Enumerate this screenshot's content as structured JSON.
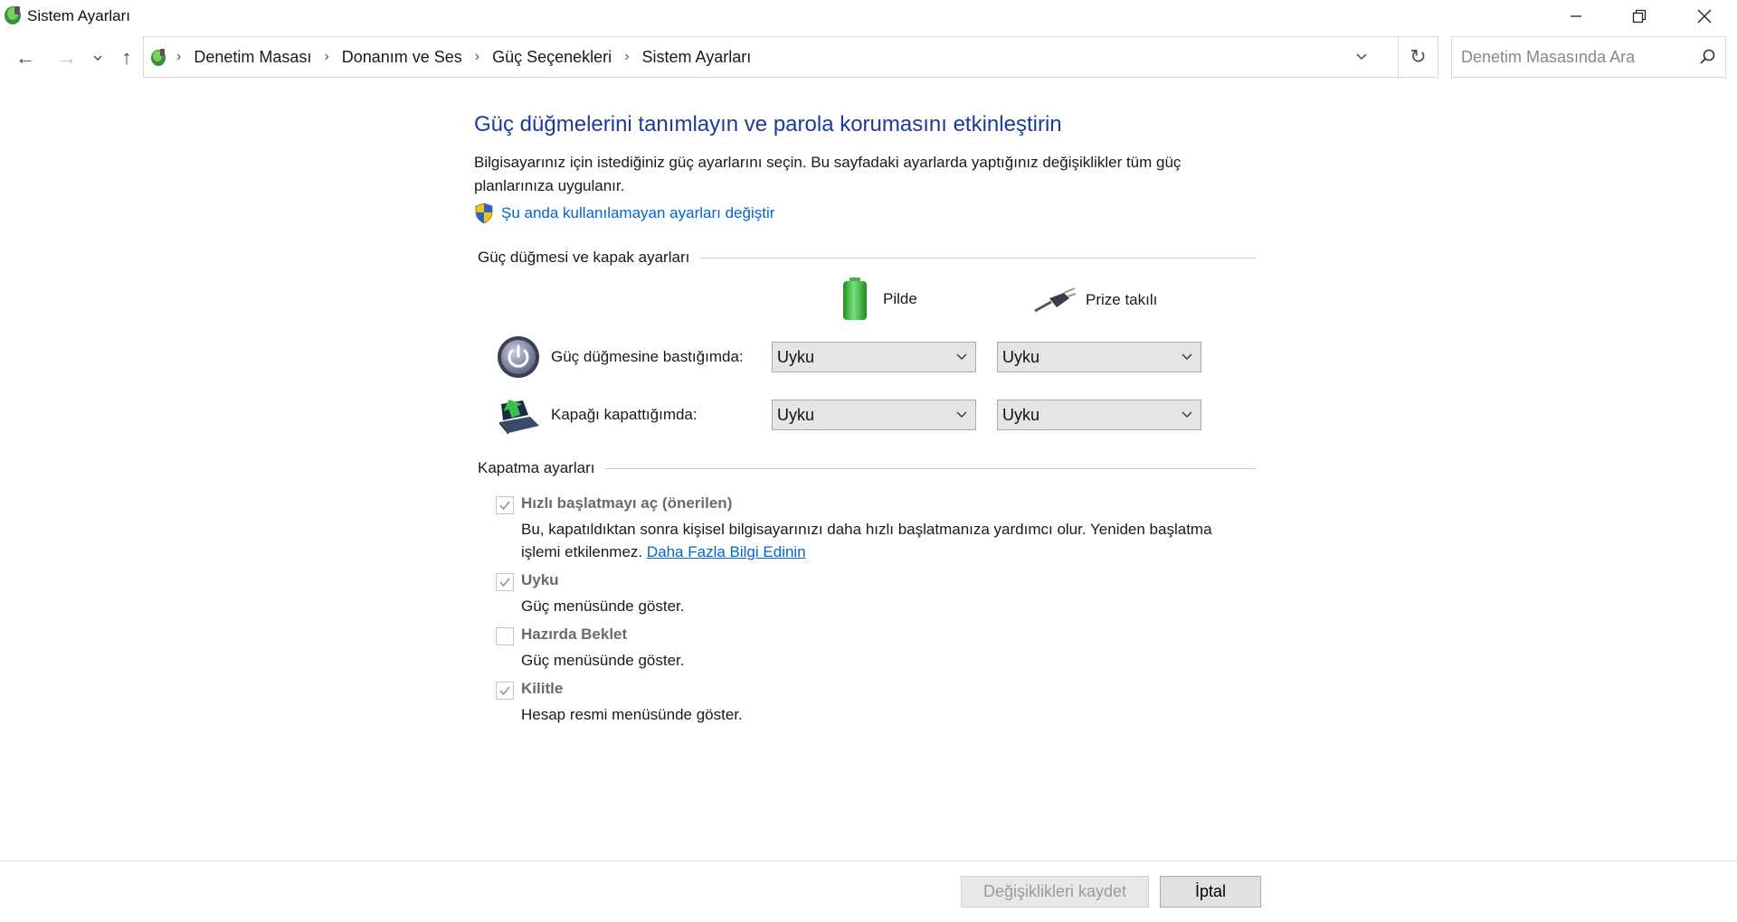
{
  "window": {
    "title": "Sistem Ayarları",
    "controls": {
      "minimize": "—",
      "restore": "❐",
      "close": "✕"
    }
  },
  "nav": {
    "back_icon": "←",
    "forward_icon": "→",
    "recent_icon": "⌄",
    "up_icon": "↑",
    "breadcrumbs": [
      "Denetim Masası",
      "Donanım ve Ses",
      "Güç Seçenekleri",
      "Sistem Ayarları"
    ],
    "refresh_icon": "↻",
    "search_placeholder": "Denetim Masasında Ara"
  },
  "main": {
    "title": "Güç düğmelerini tanımlayın ve parola korumasını etkinleştirin",
    "description": "Bilgisayarınız için istediğiniz güç ayarlarını seçin. Bu sayfadaki ayarlarda yaptığınız değişiklikler tüm güç planlarınıza uygulanır.",
    "uac_link": "Şu anda kullanılamayan ayarları değiştir",
    "power_section": {
      "header": "Güç düğmesi ve kapak ayarları",
      "col_battery": "Pilde",
      "col_plugged": "Prize takılı",
      "rows": [
        {
          "label": "Güç düğmesine bastığımda:",
          "battery": "Uyku",
          "plugged": "Uyku"
        },
        {
          "label": "Kapağı kapattığımda:",
          "battery": "Uyku",
          "plugged": "Uyku"
        }
      ]
    },
    "shutdown_section": {
      "header": "Kapatma ayarları",
      "items": [
        {
          "title": "Hızlı başlatmayı aç (önerilen)",
          "checked": true,
          "desc": "Bu, kapatıldıktan sonra kişisel bilgisayarınızı daha hızlı başlatmanıza yardımcı olur. Yeniden başlatma işlemi etkilenmez.",
          "link": "Daha Fazla Bilgi Edinin"
        },
        {
          "title": "Uyku",
          "checked": true,
          "desc": "Güç menüsünde göster."
        },
        {
          "title": "Hazırda Beklet",
          "checked": false,
          "desc": "Güç menüsünde göster."
        },
        {
          "title": "Kilitle",
          "checked": true,
          "desc": "Hesap resmi menüsünde göster."
        }
      ]
    }
  },
  "footer": {
    "save_label": "Değişiklikleri kaydet",
    "cancel_label": "İptal"
  },
  "colors": {
    "title_blue": "#1a3c96",
    "link_blue": "#0066cc",
    "battery_green": "#2db52d"
  }
}
